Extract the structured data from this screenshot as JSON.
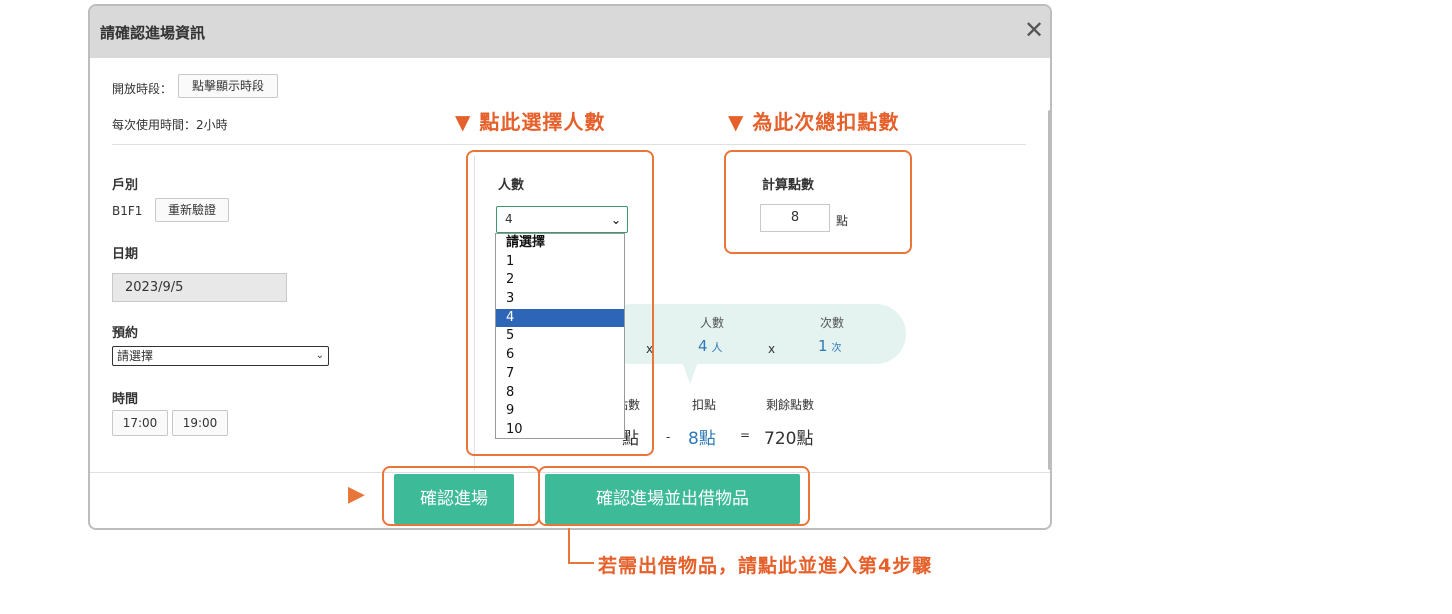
{
  "dialog": {
    "title": "請確認進場資訊",
    "close_glyph": "✕"
  },
  "open_period": {
    "label": "開放時段：",
    "button_label": "點擊顯示時段"
  },
  "usage_time": "每次使用時間：2小時",
  "household": {
    "label": "戶別",
    "value": "B1F1",
    "reverify_label": "重新驗證"
  },
  "date": {
    "label": "日期",
    "value": "2023/9/5"
  },
  "reservation": {
    "label": "預約",
    "selected": "請選擇"
  },
  "time": {
    "label": "時間",
    "slots": [
      "17:00",
      "19:00"
    ]
  },
  "people": {
    "label": "人數",
    "selected": "4",
    "options": [
      "請選擇",
      "1",
      "2",
      "3",
      "4",
      "5",
      "6",
      "7",
      "8",
      "9",
      "10"
    ]
  },
  "points_calc": {
    "label": "計算點數",
    "value": "8",
    "unit": "點"
  },
  "formula": {
    "people_header": "人數",
    "times_header": "次數",
    "mult1": "x",
    "mult2": "x",
    "people_value": "4",
    "people_unit": "人",
    "times_value": "1",
    "times_unit": "次"
  },
  "balance": {
    "col1_header_partial": "點數",
    "deduct_header": "扣點",
    "remaining_header": "剩餘點數",
    "col1_value_partial": "點",
    "minus": "-",
    "deduct_value": "8點",
    "equals": "=",
    "remaining_value": "720點"
  },
  "footer": {
    "confirm_label": "確認進場",
    "confirm_borrow_label": "確認進場並出借物品"
  },
  "annotations": {
    "select_people": "▼ 點此選擇人數",
    "total_points": "▼ 為此次總扣點數",
    "borrow_note": "若需出借物品，請點此並進入第4步驟",
    "arrow_glyph": "▶"
  },
  "colors": {
    "accent_orange": "#e8763a",
    "button_green": "#3dbb98",
    "value_blue": "#2f7ab8",
    "selected_blue": "#2e66b7",
    "bubble_teal": "#e4f3f0"
  }
}
